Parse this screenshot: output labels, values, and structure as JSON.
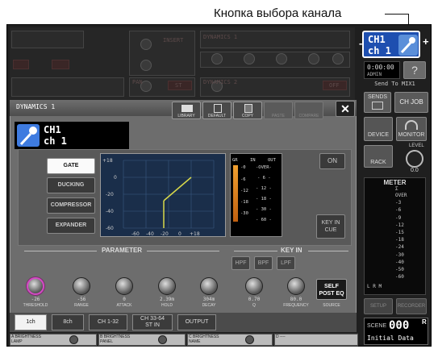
{
  "annotation": {
    "callout": "Кнопка выбора канала"
  },
  "channel_select": {
    "line1": "CH1",
    "line2": "ch 1",
    "minus": "-",
    "plus": "+"
  },
  "status": {
    "time": "0:00:00",
    "user": "ADMIN",
    "help": "?",
    "send_to": "Send To MIX1"
  },
  "right_buttons": {
    "sends": "SENDS",
    "ch_job": "CH JOB",
    "device": "DEVICE",
    "monitor": "MONITOR",
    "rack": "RACK",
    "level_label": "LEVEL",
    "level_value": "0.0",
    "setup": "SETUP",
    "recorder": "RECORDER"
  },
  "meter": {
    "title": "METER",
    "sigma": "Σ",
    "scale": [
      "OVER",
      "-3",
      "-6",
      "-9",
      "-12",
      "-15",
      "-18",
      "-24",
      "-30",
      "-40",
      "-50",
      "-60"
    ],
    "lrm": "L  R  M"
  },
  "scene": {
    "label": "SCENE",
    "number": "000",
    "r": "R",
    "name": "Initial Data"
  },
  "background": {
    "labels": [
      "INSERT",
      "DYNAMICS 1",
      "DYNAMICS 2",
      "PAN",
      "ST",
      "OFF"
    ]
  },
  "dialog": {
    "title": "DYNAMICS 1",
    "toolbar": {
      "library": "LIBRARY",
      "default": "DEFAULT",
      "copy": "COPY",
      "paste": "PASTE",
      "compare": "COMPARE"
    },
    "close": "✕",
    "channel": {
      "line1": "CH1",
      "line2": "ch 1"
    },
    "types": [
      "GATE",
      "DUCKING",
      "COMPRESSOR",
      "EXPANDER"
    ],
    "graph": {
      "y_ticks": [
        "+18",
        "0",
        "-20",
        "-40",
        "-60"
      ],
      "x_ticks": [
        "-60",
        "-40",
        "-20",
        "0",
        "+18"
      ]
    },
    "gr_meter": {
      "headers": [
        "GR",
        "IN",
        "OUT"
      ],
      "gr_scale": [
        "-0",
        "-6",
        "-12",
        "-18",
        "-30"
      ],
      "io_scale": [
        "-OVER-",
        "- 6 -",
        "- 12 -",
        "- 18 -",
        "- 30 -",
        "- 60 -"
      ]
    },
    "on_button": "ON",
    "key_in_cue": {
      "line1": "KEY IN",
      "line2": "CUE"
    },
    "parameter_section": "PARAMETER",
    "keyin_section": "KEY IN",
    "filters": [
      "HPF",
      "BPF",
      "LPF"
    ],
    "params": [
      {
        "value": "-26",
        "name": "THRESHOLD"
      },
      {
        "value": "-56",
        "name": "RANGE"
      },
      {
        "value": "0",
        "name": "ATTACK"
      },
      {
        "value": "2.39m",
        "name": "HOLD"
      },
      {
        "value": "304m",
        "name": "DECAY"
      },
      {
        "value": "0.70",
        "name": "Q"
      },
      {
        "value": "80.0",
        "name": "FREQUENCY"
      }
    ],
    "source": {
      "line1": "SELF",
      "line2": "POST EQ",
      "label": "SOURCE"
    },
    "tabs": [
      "1ch",
      "8ch",
      "CH 1-32",
      "CH 33-64\nST IN",
      "OUTPUT"
    ]
  },
  "bottom_strip": [
    {
      "letter": "A",
      "label": "BRIGHTNESS\nLAMP"
    },
    {
      "letter": "B",
      "label": "BRIGHTNESS\nPANEL"
    },
    {
      "letter": "C",
      "label": "BRIGHTNESS\nNAME"
    },
    {
      "letter": "D",
      "label": "----"
    }
  ]
}
